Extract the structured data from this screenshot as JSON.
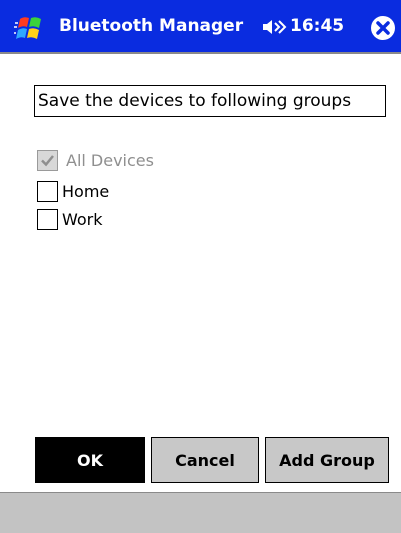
{
  "titlebar": {
    "app_title": "Bluetooth Manager",
    "time": "16:45",
    "start_icon": "windows-flag-icon",
    "volume_icon": "speaker-icon",
    "close_icon": "close-icon"
  },
  "main": {
    "prompt": "Save the devices to following groups",
    "groups": [
      {
        "label": "All Devices",
        "checked": true,
        "enabled": false
      },
      {
        "label": "Home",
        "checked": false,
        "enabled": true
      },
      {
        "label": "Work",
        "checked": false,
        "enabled": true
      }
    ]
  },
  "buttons": {
    "ok": "OK",
    "cancel": "Cancel",
    "add_group": "Add Group"
  },
  "colors": {
    "titlebar_bg": "#0a2ce0",
    "button_bg": "#c8c8c8",
    "menubar_bg": "#c3c3c3"
  }
}
